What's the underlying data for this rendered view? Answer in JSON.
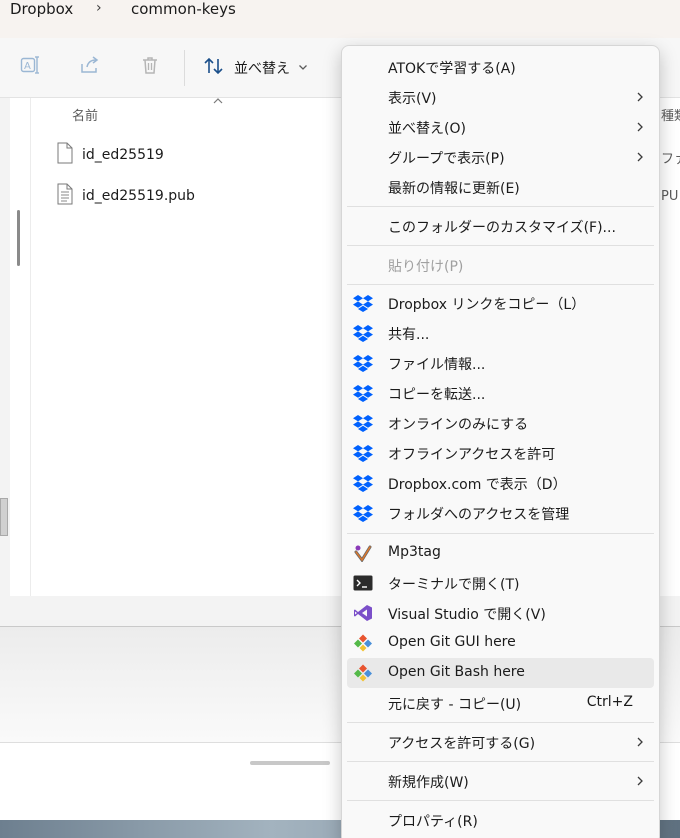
{
  "breadcrumb": {
    "items": [
      "Dropbox",
      "common-keys"
    ],
    "separator": "›"
  },
  "toolbar": {
    "sort_label": "並べ替え",
    "icons": [
      "rename-icon",
      "share-icon",
      "trash-icon",
      "sort-icon",
      "chevron-down-icon"
    ]
  },
  "file_list": {
    "column_header": "名前",
    "files": [
      {
        "name": "id_ed25519",
        "icon": "file-icon"
      },
      {
        "name": "id_ed25519.pub",
        "icon": "text-file-icon"
      }
    ],
    "peek_header": "種類",
    "peek_values": [
      "ファ",
      "PU"
    ]
  },
  "context_menu": {
    "items": [
      {
        "label": "ATOKで学習する(A)"
      },
      {
        "label": "表示(V)",
        "submenu": true
      },
      {
        "label": "並べ替え(O)",
        "submenu": true
      },
      {
        "label": "グループで表示(P)",
        "submenu": true
      },
      {
        "label": "最新の情報に更新(E)"
      },
      {
        "label": "このフォルダーのカスタマイズ(F)..."
      },
      {
        "label": "貼り付け(P)",
        "disabled": true
      },
      {
        "label": "Dropbox リンクをコピー（L）",
        "icon": "dropbox-icon"
      },
      {
        "label": "共有...",
        "icon": "dropbox-icon"
      },
      {
        "label": "ファイル情報...",
        "icon": "dropbox-icon"
      },
      {
        "label": "コピーを転送...",
        "icon": "dropbox-icon"
      },
      {
        "label": "オンラインのみにする",
        "icon": "dropbox-icon"
      },
      {
        "label": "オフラインアクセスを許可",
        "icon": "dropbox-icon"
      },
      {
        "label": "Dropbox.com で表示（D）",
        "icon": "dropbox-icon"
      },
      {
        "label": "フォルダへのアクセスを管理",
        "icon": "dropbox-icon"
      },
      {
        "label": "Mp3tag",
        "icon": "mp3tag-icon"
      },
      {
        "label": "ターミナルで開く(T)",
        "icon": "terminal-icon"
      },
      {
        "label": "Visual Studio で開く(V)",
        "icon": "visual-studio-icon"
      },
      {
        "label": "Open Git GUI here",
        "icon": "git-icon"
      },
      {
        "label": "Open Git Bash here",
        "icon": "git-icon",
        "highlighted": true
      },
      {
        "label": "元に戻す - コピー(U)",
        "shortcut": "Ctrl+Z"
      },
      {
        "label": "アクセスを許可する(G)",
        "submenu": true
      },
      {
        "label": "新規作成(W)",
        "submenu": true
      },
      {
        "label": "プロパティ(R)"
      }
    ]
  },
  "colors": {
    "dropbox": "#0061fe",
    "accent": "#0067c0",
    "menu_bg": "#f9f9f9",
    "hover_bg": "#e9e9e9"
  }
}
